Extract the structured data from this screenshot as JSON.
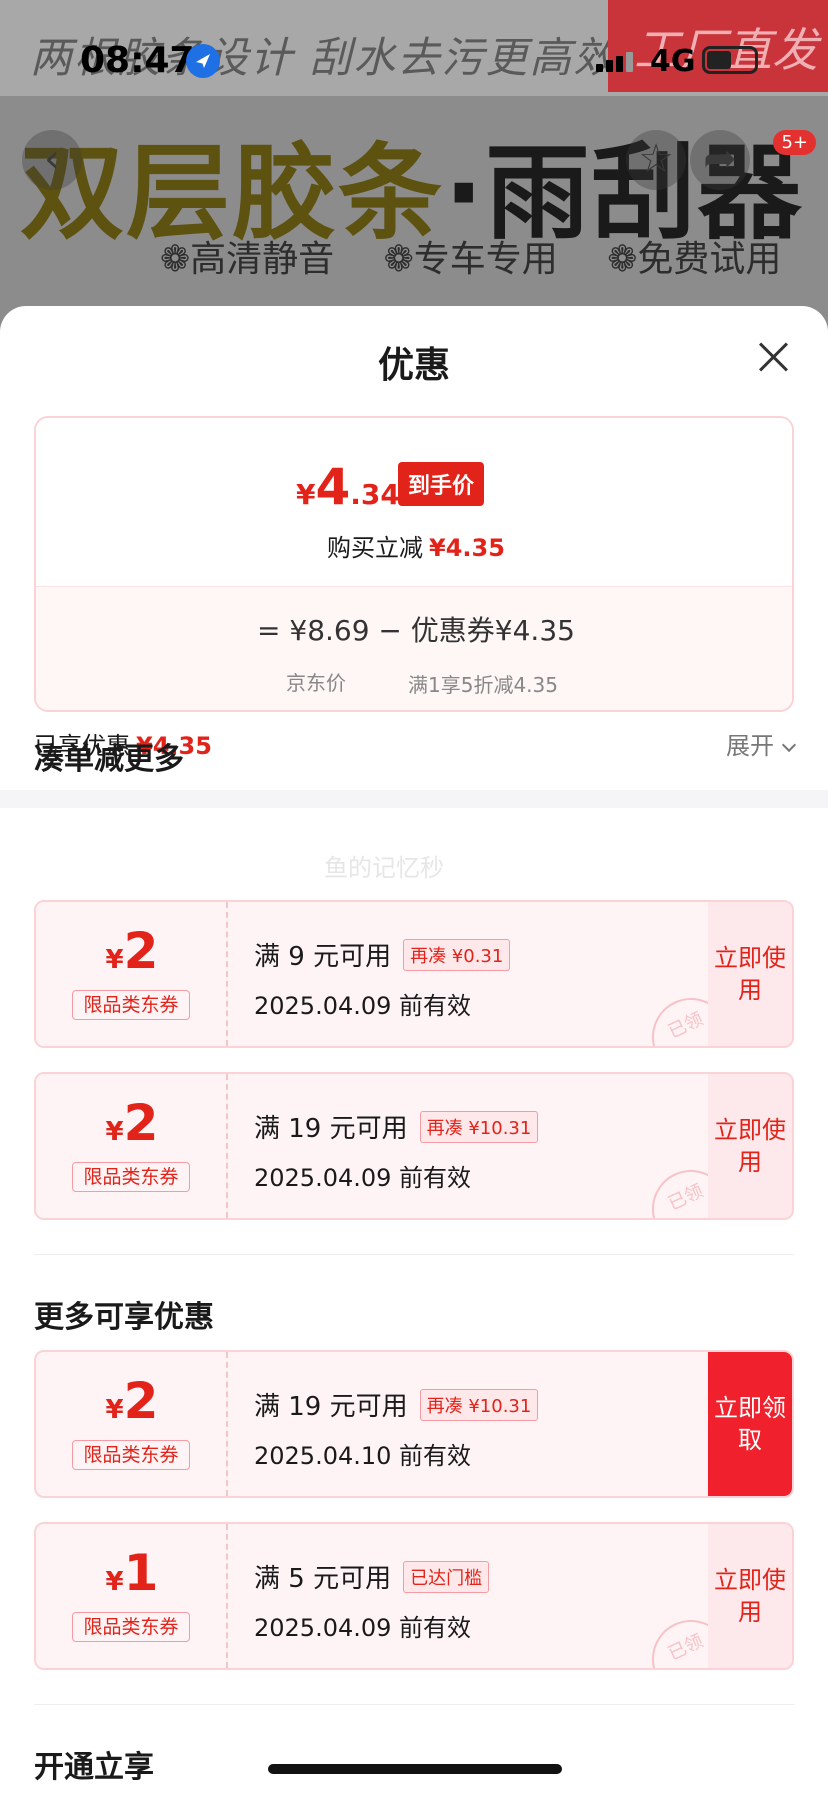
{
  "background": {
    "slogan": "两根胶条设计 刮水去污更高效",
    "red_tag": "工厂直发",
    "headline_part1": "双层胶条",
    "headline_part2": "·雨刮器",
    "features": [
      "❁高清静音",
      "❁专车专用",
      "❁免费试用"
    ],
    "cart_badge": "5+",
    "back_icon": "chevron-left-icon",
    "star_icon": "star-icon",
    "share_icon": "share-icon"
  },
  "status_bar": {
    "time": "08:47",
    "network": "4G"
  },
  "sheet": {
    "title": "优惠",
    "price_card": {
      "currency": "¥",
      "price_int": "4",
      "price_dec": ".34",
      "final_tag": "到手价",
      "instant_label": "购买立减",
      "instant_value": "¥4.35",
      "formula": "= ¥8.69 − 优惠券¥4.35",
      "sub_jd": "京东价",
      "sub_coupon": "满1享5折减4.35"
    },
    "enjoyed": {
      "label": "已享优惠",
      "value": "¥4.35",
      "expand": "展开"
    },
    "section1_title": "凑单减更多",
    "watermark": "鱼的记忆秒",
    "section2_title": "更多可享优惠",
    "section3_title": "开通立享",
    "coupons": [
      {
        "currency": "¥",
        "amount": "2",
        "type": "限品类东券",
        "condition": "满 9 元可用",
        "tag": "再凑 ¥0.31",
        "date": "2025.04.09 前有效",
        "button": "立即使用",
        "stamp": "已领"
      },
      {
        "currency": "¥",
        "amount": "2",
        "type": "限品类东券",
        "condition": "满 19 元可用",
        "tag": "再凑 ¥10.31",
        "date": "2025.04.09 前有效",
        "button": "立即使用",
        "stamp": "已领"
      },
      {
        "currency": "¥",
        "amount": "2",
        "type": "限品类东券",
        "condition": "满 19 元可用",
        "tag": "再凑 ¥10.31",
        "date": "2025.04.10 前有效",
        "button": "立即领取",
        "stamp": ""
      },
      {
        "currency": "¥",
        "amount": "1",
        "type": "限品类东券",
        "condition": "满 5 元可用",
        "tag": "已达门槛",
        "date": "2025.04.09 前有效",
        "button": "立即使用",
        "stamp": "已领"
      }
    ]
  }
}
